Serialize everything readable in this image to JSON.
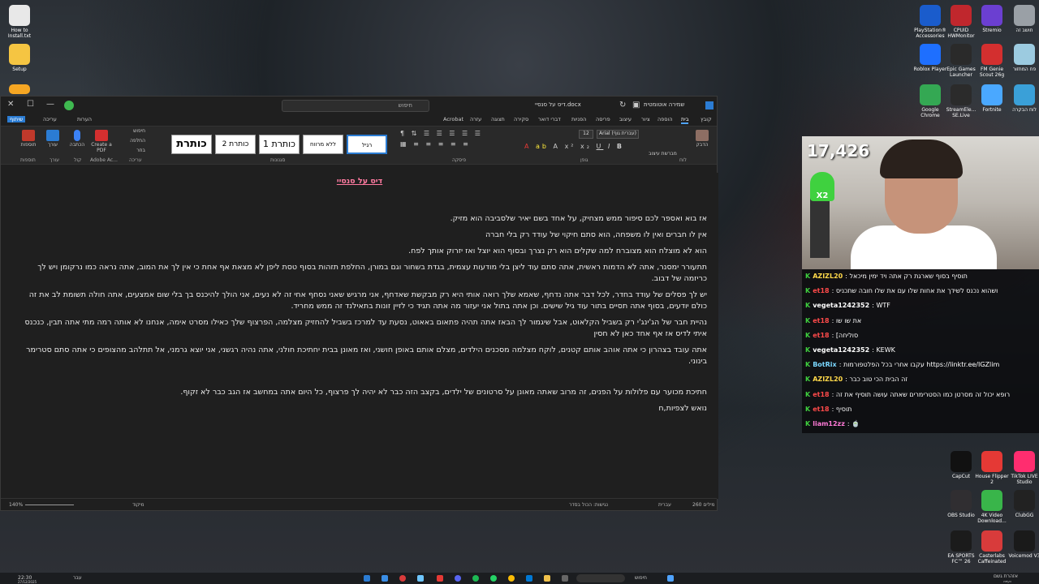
{
  "desktop": {
    "left_icons": [
      {
        "label": "How to Install.txt",
        "color": "#e8e8e8"
      },
      {
        "label": "Setup",
        "color": "#f5c542"
      },
      {
        "label": "",
        "color": "#f5a623"
      }
    ],
    "right_icons": [
      {
        "label": "PlayStation® Accessories",
        "color": "#1a5ccc"
      },
      {
        "label": "CPUID HWMonitor",
        "color": "#c0272d"
      },
      {
        "label": "Stremio",
        "color": "#6b3fd1"
      },
      {
        "label": "חושב זה",
        "color": "#9aa0a6"
      },
      {
        "label": "Roblox Player",
        "color": "#1e6fff"
      },
      {
        "label": "Epic Games Launcher",
        "color": "#2a2a2a"
      },
      {
        "label": "FM Genie Scout 26g",
        "color": "#d32f2f"
      },
      {
        "label": "פח המחזור",
        "color": "#9ccbe0"
      },
      {
        "label": "Google Chrome",
        "color": "#34a853"
      },
      {
        "label": "StreamEle... SE.Live",
        "color": "#2b2b2b"
      },
      {
        "label": "Fortnite",
        "color": "#4aa8ff"
      },
      {
        "label": "לוח הבקרה",
        "color": "#3aa0d8"
      },
      {
        "label": "CapCut",
        "color": "#111111"
      },
      {
        "label": "House Flipper 2",
        "color": "#e53935"
      },
      {
        "label": "TikTok LIVE Studio",
        "color": "#ff2d6f"
      },
      {
        "label": "OBS Studio",
        "color": "#302e31"
      },
      {
        "label": "4K Video Download...",
        "color": "#39b54a"
      },
      {
        "label": "ClubGG",
        "color": "#222222"
      },
      {
        "label": "EA SPORTS FC™ 26",
        "color": "#1b1b1b"
      },
      {
        "label": "Casterlabs Caffeinated",
        "color": "#d83b3b"
      },
      {
        "label": "Voicemod V3",
        "color": "#1a1a1a"
      }
    ]
  },
  "word": {
    "titlebar": {
      "doc_title": "דיס על סנסיי.docx",
      "autosave": "שמירה אוטומטית",
      "search_placeholder": "חיפוש"
    },
    "tabs": [
      "קובץ",
      "בית",
      "הוספה",
      "ציור",
      "עיצוב",
      "פריסה",
      "הפניות",
      "דברי דואר",
      "סקירה",
      "תצוגה",
      "עזרה",
      "Acrobat"
    ],
    "right_buttons": {
      "comments": "הערות",
      "editing": "עריכה",
      "share": "שיתוף"
    },
    "ribbon": {
      "font_name": "Arial (עברית גוף)",
      "font_size": "12",
      "styles": [
        "רגיל",
        "ללא מרווח",
        "כותרת 1",
        "כותרת 2",
        "כותרת"
      ],
      "groups": {
        "clipboard": "לוח",
        "font": "גופן",
        "paragraph": "פיסקה",
        "styles": "סגנונות",
        "editing": "עריכה",
        "adobe": "Adobe Ac...",
        "voice": "קול",
        "editor": "עורך",
        "addins": "תוספות"
      },
      "right_tools": [
        "חיפוש",
        "החלפה",
        "בחר"
      ],
      "labels": {
        "create_pdf": "Create a PDF",
        "dictate": "הכתבה",
        "editor": "עורך",
        "addins": "תוספות",
        "paste": "הדבק",
        "format_painter": "מברשת עיצוב"
      }
    },
    "document": {
      "title": "דיס על סנסיי",
      "paragraphs": [
        "אז בוא ואספר לכם סיפור ממש מצחיק, על אחד בשם יאיר שלסביבה הוא מזיק.",
        "אין לו חברים ואין לו משפחה, הוא סתם חיקוי של עודד רק בלי חברה",
        "הוא לא מוצלח הוא מצוברח למה שקלים הוא רק נצרך ובסוף הוא יוצל ואז יזרוק אותך לפח.",
        "תתעורר ימסנר, אתה לא הדמות ראשית, אתה סתם עוד ליצן בלי מודעות עצמית, בגדת בשחור וגם במורן, החלפת תזהות בסוף טסת ליפן לא מצאת אף אחת כי אין לך את המוב, אתה נראה כמו נרקומן ויש לך כריזמה של דבוב.",
        "יש לך פסלים של עודד בחדר, לכל דבר אתה נדחף, שאמא שלך רואה אותי היא רק מבקשת שאדחף, אני מרגיש שאני נסחף אחי זה לא נעים, אני הולך להיכנס בך בלי שום אמצעים, אתה חולה תשומת לב את זה כולם יודעים, בסוף אתה תסיים בתור עוד גיל שישים. וכן אתה בתול אני יעזור מה אתה תגיד כי לזיין זונות בתאילנד זה ממש מחריד.",
        "נהיית חבר של הג'ינג'י רק בשביל הקלאוט, אבל שיגמור לך הבאז אתה תהיה פתאום באאוט, נסעת עד למרכז בשביל להחזיק מצלמה, הפרצוף שלך כאילו מסרט אימה, אנחנו לא אותה רמה מתי אתה תבין, כנכנס איתי לדיס אז אף אחד כאן לא חסין",
        "אתה עובד בצהרון כי אתה אוהב אותם קטנים, לוקח מצלמה מסכנים הילדים, מצלם אותם באופן חושני, ואז מאונן בבית יחתיכת חולני, אתה נהיה רגשני, אני יוצא גרמני, אל תתלהב מהצופים כי אתה סתם סטרימר בינוני.",
        "",
        "חתיכת מכוער עם פלולות על הפנים, זה מרוב שאתה מאונן על סרטונים של ילדים, בקצב הזה כבר לא יהיה לך פרצוף, כל היום אתה במחשב אז הגב כבר לא זקוף.",
        "נואש לצפיות,ח"
      ]
    },
    "statusbar": {
      "zoom": "140%",
      "focus": "מיקוד",
      "page_info": "260 מילים",
      "language": "עברית",
      "accessibility": "נגישות: הכול בסדר"
    }
  },
  "stream": {
    "viewer_count": "17,426",
    "badge": "X2",
    "chat": [
      {
        "user": "AZIZL20",
        "user_color": "#ffd94a",
        "text": "תוסיף בסוף שארגת רק אתה ויד ימין מיכאל"
      },
      {
        "user": "et18",
        "user_color": "#ff4a4a",
        "text": "ושהוא נכנס לשידך את אחות שלו עם את שלו חובה שתכניס"
      },
      {
        "user": "vegeta1242352",
        "user_color": "#ffffff",
        "text": "WTF"
      },
      {
        "user": "et18",
        "user_color": "#ff4a4a",
        "text": "את שו שו"
      },
      {
        "user": "et18",
        "user_color": "#ff4a4a",
        "text": "[סוליחה"
      },
      {
        "user": "vegeta1242352",
        "user_color": "#ffffff",
        "text": "KEWK"
      },
      {
        "user": "BotRix",
        "user_color": "#7ad7ff",
        "text": "עקבו אחרי בכל הפלטפורמות https://linktr.ee/IGZlim"
      },
      {
        "user": "AZIZL20",
        "user_color": "#ffd94a",
        "text": "זה הבית הכי טוב כבר"
      },
      {
        "user": "et18",
        "user_color": "#ff4a4a",
        "text": "רופא יכול זה מסרטן כמו הסטרימרים שאתה עושה תוסיף את זה"
      },
      {
        "user": "et18",
        "user_color": "#ff4a4a",
        "text": "תוסיף"
      },
      {
        "user": "liam12zz",
        "user_color": "#ff7ad7",
        "text": "🍵"
      }
    ]
  },
  "taskbar": {
    "time": "22:30",
    "date": "27/12/2025",
    "lang": "עבר",
    "search": "חיפוש",
    "weather": "אזהרת גשם",
    "weather_sub": "כעתה"
  }
}
